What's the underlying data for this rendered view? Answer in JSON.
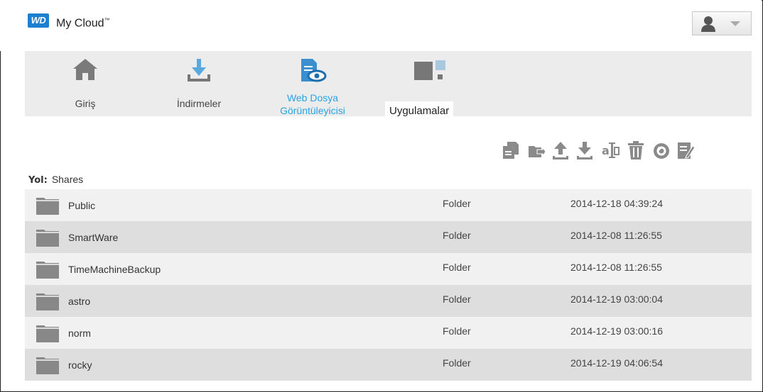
{
  "header": {
    "logo_text": "WD",
    "title": "My Cloud",
    "title_mark": "™"
  },
  "nav": {
    "items": [
      {
        "label": "Giriş",
        "icon": "home-icon"
      },
      {
        "label": "İndirmeler",
        "icon": "download-icon"
      },
      {
        "label": "Web Dosya Görüntüleyicisi",
        "label_line1": "Web Dosya",
        "label_line2": "Görüntüleyicisi",
        "icon": "web-file-viewer-icon",
        "active": true
      },
      {
        "label": "Uygulamalar",
        "icon": "apps-icon"
      }
    ]
  },
  "toolbar": {
    "icons": [
      "copy-icon",
      "move-icon",
      "upload-icon",
      "download-icon",
      "rename-icon",
      "delete-icon",
      "refresh-icon",
      "edit-icon"
    ]
  },
  "path": {
    "label": "Yol:",
    "value": "Shares"
  },
  "files": [
    {
      "name": "Public",
      "type": "Folder",
      "date": "2014-12-18 04:39:24"
    },
    {
      "name": "SmartWare",
      "type": "Folder",
      "date": "2014-12-08 11:26:55"
    },
    {
      "name": "TimeMachineBackup",
      "type": "Folder",
      "date": "2014-12-08 11:26:55"
    },
    {
      "name": "astro",
      "type": "Folder",
      "date": "2014-12-19 03:00:04"
    },
    {
      "name": "norm",
      "type": "Folder",
      "date": "2014-12-19 03:00:16"
    },
    {
      "name": "rocky",
      "type": "Folder",
      "date": "2014-12-19 04:06:54"
    }
  ],
  "colors": {
    "accent": "#2aa3e0",
    "brand": "#1d7fcf",
    "icon_gray": "#8a8a8a",
    "nav_icon_blue": "#3a8fd0"
  }
}
